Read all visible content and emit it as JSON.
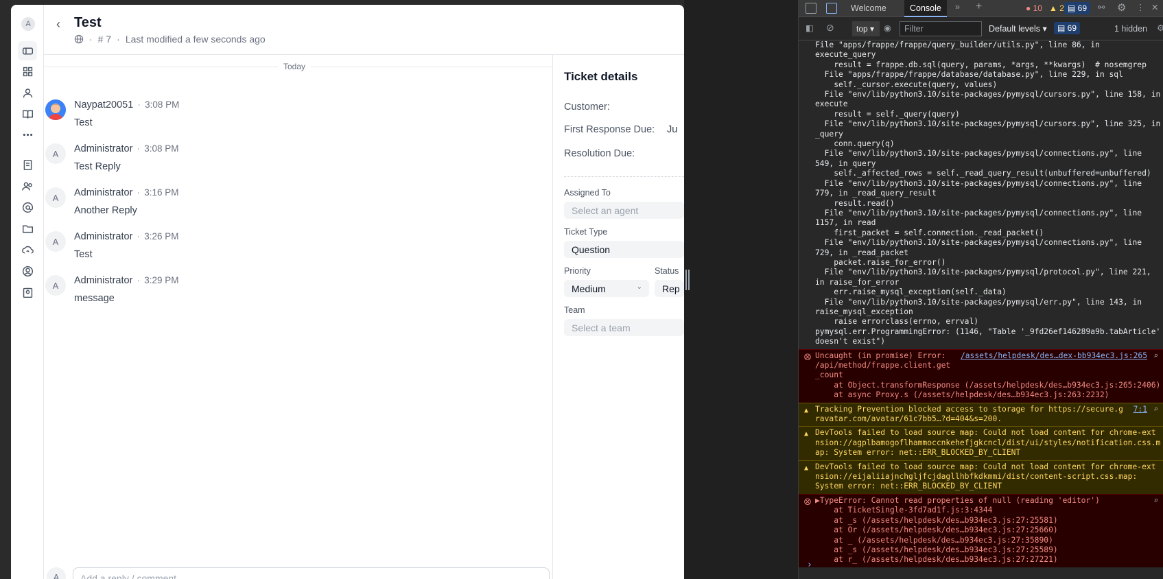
{
  "app": {
    "user_initial": "A",
    "ticket_title": "Test",
    "ticket_number": "# 7",
    "last_modified": "Last modified a few seconds ago",
    "back_glyph": "‹",
    "date_divider": "Today",
    "messages": [
      {
        "author": "Naypat20051",
        "time": "3:08 PM",
        "body": "Test",
        "avatar": "photo"
      },
      {
        "author": "Administrator",
        "time": "3:08 PM",
        "body": "Test Reply",
        "avatar": "A"
      },
      {
        "author": "Administrator",
        "time": "3:16 PM",
        "body": "Another Reply",
        "avatar": "A"
      },
      {
        "author": "Administrator",
        "time": "3:26 PM",
        "body": "Test",
        "avatar": "A"
      },
      {
        "author": "Administrator",
        "time": "3:29 PM",
        "body": "message",
        "avatar": "A"
      }
    ],
    "reply_initial": "A",
    "reply_placeholder": "Add a reply / comment",
    "details": {
      "heading": "Ticket details",
      "customer_label": "Customer:",
      "first_response_label": "First Response Due:",
      "first_response_value": "Ju",
      "resolution_label": "Resolution Due:",
      "assigned_label": "Assigned To",
      "assigned_placeholder": "Select an agent",
      "type_label": "Ticket Type",
      "type_value": "Question",
      "priority_label": "Priority",
      "priority_value": "Medium",
      "status_label": "Status",
      "status_value": "Rep",
      "team_label": "Team",
      "team_placeholder": "Select a team"
    }
  },
  "devtools": {
    "tabs": [
      "Welcome",
      "Console"
    ],
    "active_tab": "Console",
    "errors_count": "10",
    "warnings_count": "2",
    "messages_count": "69",
    "context": "top",
    "filter_placeholder": "Filter",
    "levels": "Default levels",
    "levels_badge": "69",
    "hidden": "1 hidden",
    "log_lines": [
      "File \"apps/frappe/frappe/query_builder/utils.py\", line 86, in",
      "execute_query",
      "    result = frappe.db.sql(query, params, *args, **kwargs)  # nosemgrep",
      "  File \"apps/frappe/frappe/database/database.py\", line 229, in sql",
      "    self._cursor.execute(query, values)",
      "  File \"env/lib/python3.10/site-packages/pymysql/cursors.py\", line 158, in",
      "execute",
      "    result = self._query(query)",
      "  File \"env/lib/python3.10/site-packages/pymysql/cursors.py\", line 325, in",
      "_query",
      "    conn.query(q)",
      "  File \"env/lib/python3.10/site-packages/pymysql/connections.py\", line",
      "549, in query",
      "    self._affected_rows = self._read_query_result(unbuffered=unbuffered)",
      "  File \"env/lib/python3.10/site-packages/pymysql/connections.py\", line",
      "779, in _read_query_result",
      "    result.read()",
      "  File \"env/lib/python3.10/site-packages/pymysql/connections.py\", line",
      "1157, in read",
      "    first_packet = self.connection._read_packet()",
      "  File \"env/lib/python3.10/site-packages/pymysql/connections.py\", line",
      "729, in _read_packet",
      "    packet.raise_for_error()",
      "  File \"env/lib/python3.10/site-packages/pymysql/protocol.py\", line 221,",
      "in raise_for_error",
      "    err.raise_mysql_exception(self._data)",
      "  File \"env/lib/python3.10/site-packages/pymysql/err.py\", line 143, in",
      "raise_mysql_exception",
      "    raise errorclass(errno, errval)",
      "pymysql.err.ProgrammingError: (1146, \"Table '_9fd26ef146289a9b.tabArticle'",
      "doesn't exist\")"
    ],
    "entry1": {
      "lines": [
        "Uncaught (in promise) Error:",
        "/api/method/frappe.client.get",
        "_count",
        "    at Object.transformResponse (/assets/helpdesk/des…b934ec3.js:265:2406)",
        "    at async Proxy.s (/assets/helpdesk/des…b934ec3.js:263:2232)"
      ],
      "source": "/assets/helpdesk/des…dex-bb934ec3.js:265"
    },
    "entry2": {
      "lines": [
        "Tracking Prevention blocked access to storage for https://secure.g",
        "ravatar.com/avatar/61c7bb5…?d=404&s=200."
      ],
      "source": "7:1"
    },
    "entry3": {
      "lines": [
        "DevTools failed to load source map: Could not load content for chrome-ext",
        "nsion://agplbamogoflhammoccnkehefjgkcncl/dist/ui/styles/notification.css.m",
        "ap: System error: net::ERR_BLOCKED_BY_CLIENT"
      ]
    },
    "entry4": {
      "lines": [
        "DevTools failed to load source map: Could not load content for chrome-ext",
        "nsion://eijaliiajnchgljfcjdagllhbfkdkmmi/dist/content-script.css.map:",
        "System error: net::ERR_BLOCKED_BY_CLIENT"
      ]
    },
    "entry5": {
      "lines": [
        "▶TypeError: Cannot read properties of null (reading 'editor')",
        "    at TicketSingle-3fd7ad1f.js:3:4344",
        "    at _s (/assets/helpdesk/des…b934ec3.js:27:25581)",
        "    at Or (/assets/helpdesk/des…b934ec3.js:27:25660)",
        "    at _ (/assets/helpdesk/des…b934ec3.js:27:35890)",
        "    at _s (/assets/helpdesk/des…b934ec3.js:27:25589)",
        "    at r_ (/assets/helpdesk/des…b934ec3.js:27:27221)"
      ]
    },
    "prompt": "›"
  }
}
